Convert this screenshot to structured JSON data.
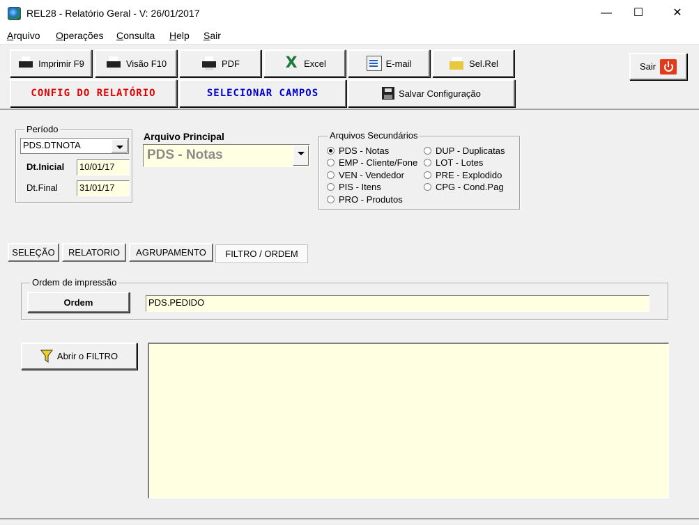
{
  "window": {
    "title": "REL28 - Relatório Geral - V: 26/01/2017",
    "minimize": "—",
    "maximize": "☐",
    "close": "✕"
  },
  "menu": [
    "Arquivo",
    "Operações",
    "Consulta",
    "Help",
    "Sair"
  ],
  "toolbar": {
    "print": "Imprimir F9",
    "preview": "Visão F10",
    "pdf": "PDF",
    "excel": "Excel",
    "email": "E-mail",
    "selrel": "Sel.Rel",
    "exit": "Sair",
    "config": "CONFIG DO RELATÓRIO",
    "select_fields": "SELECIONAR CAMPOS",
    "save_config": "Salvar Configuração",
    "excel_glyph": "X"
  },
  "periodo": {
    "title": "Período",
    "field": "PDS.DTNOTA",
    "dt_inicial_label": "Dt.Inicial",
    "dt_inicial": "10/01/17",
    "dt_final_label": "Dt.Final",
    "dt_final": "31/01/17"
  },
  "arquivo_principal": {
    "label": "Arquivo Principal",
    "value": "PDS - Notas"
  },
  "arquivos_secundarios": {
    "title": "Arquivos Secundários",
    "options": [
      "PDS - Notas",
      "EMP - Cliente/Fone",
      "VEN - Vendedor",
      "PIS - Itens",
      "PRO - Produtos",
      "DUP - Duplicatas",
      "LOT - Lotes",
      "PRE - Explodido",
      "CPG - Cond.Pag"
    ],
    "selected": "PDS - Notas"
  },
  "tabs": [
    "SELEÇÃO",
    "RELATORIO",
    "AGRUPAMENTO",
    "FILTRO / ORDEM"
  ],
  "active_tab": "FILTRO / ORDEM",
  "ordem": {
    "title": "Ordem de impressão",
    "button": "Ordem",
    "value": "PDS.PEDIDO"
  },
  "filtro": {
    "button": "Abrir o FILTRO",
    "text": ""
  },
  "colors": {
    "field_bg": "#ffffe1",
    "config_text": "#e00000",
    "select_text": "#0000cc"
  },
  "icons": [
    "app-icon",
    "printer-icon",
    "pdf-printer-icon",
    "excel-icon",
    "email-icon",
    "selrel-icon",
    "save-disk-icon",
    "power-icon",
    "funnel-icon"
  ]
}
